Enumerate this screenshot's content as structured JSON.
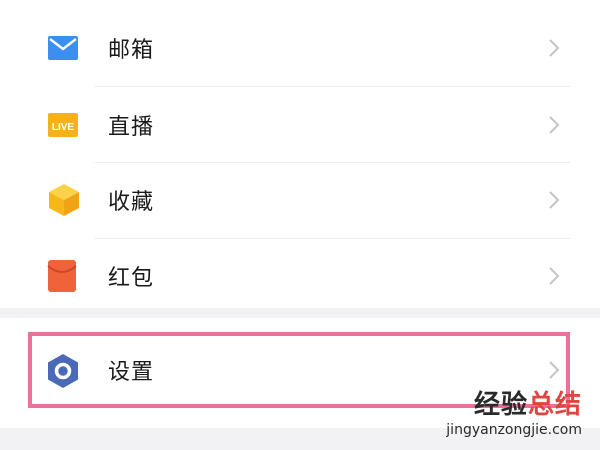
{
  "menu": {
    "items": [
      {
        "label": "邮箱",
        "icon": "mail-icon",
        "color": "#3a8ff1"
      },
      {
        "label": "直播",
        "icon": "live-icon",
        "color": "#f7b21b",
        "badge": "LIVE"
      },
      {
        "label": "收藏",
        "icon": "favorites-box-icon",
        "color": "#f7c423"
      },
      {
        "label": "红包",
        "icon": "red-packet-icon",
        "color": "#f0623a"
      },
      {
        "label": "设置",
        "icon": "settings-hexagon-icon",
        "color": "#4a69b6"
      }
    ]
  },
  "highlight_color": "#e8729a",
  "watermark": {
    "title_part1": "经验",
    "title_part2": "总结",
    "url": "jingyanzongjie.com"
  }
}
